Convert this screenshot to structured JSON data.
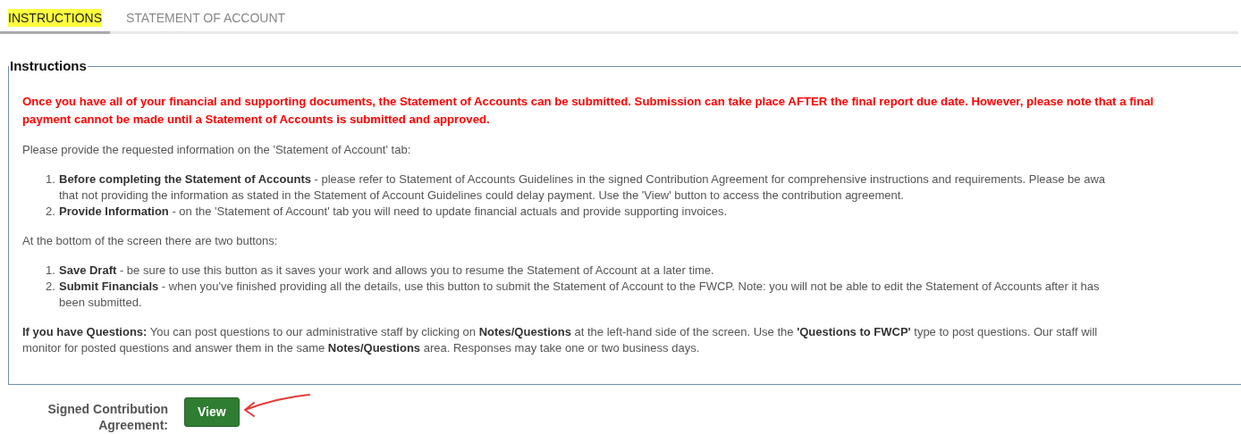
{
  "tabs": [
    {
      "label": "INSTRUCTIONS",
      "selected": true,
      "highlighted": true
    },
    {
      "label": "STATEMENT OF ACCOUNT",
      "selected": false,
      "highlighted": false
    }
  ],
  "instructions": {
    "legend": "Instructions",
    "warning_lines": [
      "Once you have all of your financial and supporting documents, the Statement of Accounts can be submitted. Submission can take place AFTER the final report due date. However, please note that a final",
      "payment cannot be made until a Statement of Accounts is submitted and approved."
    ],
    "intro": "Please provide the requested information on the 'Statement of Account' tab:",
    "steps": [
      {
        "number": "1.",
        "lines": [
          "**Before completing the Statement of Accounts** - please refer to Statement of Accounts Guidelines in the signed Contribution Agreement for comprehensive instructions and requirements. Please be awa",
          "that not providing the information as stated in the Statement of Account Guidelines could delay payment. Use the 'View' button to access the contribution agreement."
        ]
      },
      {
        "number": "2.",
        "lines": [
          "**Provide Information** - on the 'Statement of Account' tab you will need to update financial actuals and provide supporting invoices."
        ]
      }
    ],
    "buttons_intro": "At the bottom of the screen there are two buttons:",
    "button_steps": [
      {
        "number": "1.",
        "lines": [
          "**Save Draft** - be sure to use this button as it saves your work and allows you to resume the Statement of Account at a later time."
        ]
      },
      {
        "number": "2.",
        "lines": [
          "**Submit Financials** - when you've finished providing all the details, use this button to submit the Statement of Account to the FWCP. Note: you will not be able to edit the Statement of Accounts after it has",
          "been submitted."
        ]
      }
    ],
    "questions_lines": [
      "**If you have Questions:** You can post questions to our administrative staff by clicking on **Notes/Questions** at the left-hand side of the screen. Use the **'Questions to FWCP'** type to post questions. Our staff will",
      "monitor for posted questions and answer them in the same **Notes/Questions** area. Responses may take one or two business days."
    ]
  },
  "agreement": {
    "label_lines": [
      "Signed Contribution",
      "Agreement:"
    ],
    "button": "View"
  }
}
